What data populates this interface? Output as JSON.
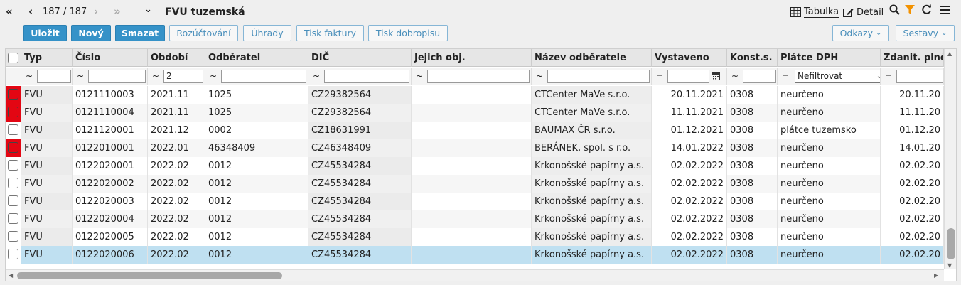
{
  "nav": {
    "first": "«",
    "prev": "‹",
    "counter": "187 / 187",
    "next": "›",
    "last": "»",
    "menu_caret": "⌄",
    "title": "FVU tuzemská"
  },
  "views": {
    "table_label": "Tabulka",
    "detail_label": "Detail"
  },
  "toolbar": {
    "save": "Uložit",
    "new": "Nový",
    "delete": "Smazat",
    "accounting": "Rozúčtování",
    "payments": "Úhrady",
    "print_invoice": "Tisk faktury",
    "print_credit": "Tisk dobropisu",
    "links": "Odkazy",
    "reports": "Sestavy"
  },
  "colors": {
    "primary": "#3592c8",
    "flag_red": "#e30613",
    "selected_row": "#bfe0f1"
  },
  "table": {
    "headers": [
      "Typ",
      "Číslo",
      "Období",
      "Odběratel",
      "DIČ",
      "Jejich obj.",
      "Název odběratele",
      "Vystaveno",
      "Konst.s.",
      "Plátce DPH",
      "Zdanit. plněn"
    ],
    "filters": {
      "ops": [
        "~",
        "~",
        "~",
        "~",
        "~",
        "~",
        "~",
        "=",
        "~",
        "=",
        "="
      ],
      "period_value": "2",
      "vat_payer_select": "Nefiltrovat"
    },
    "rows": [
      {
        "flag": true,
        "typ": "FVU",
        "cislo": "0121110003",
        "obdobi": "2021.11",
        "odberatel": "1025",
        "dic": "CZ29382564",
        "obj": "",
        "nazev": "CTCenter MaVe s.r.o.",
        "vystaveno": "20.11.2021",
        "ks": "0308",
        "platce": "neurčeno",
        "zdan": "20.11.20"
      },
      {
        "flag": true,
        "typ": "FVU",
        "cislo": "0121110004",
        "obdobi": "2021.11",
        "odberatel": "1025",
        "dic": "CZ29382564",
        "obj": "",
        "nazev": "CTCenter MaVe s.r.o.",
        "vystaveno": "11.11.2021",
        "ks": "0308",
        "platce": "neurčeno",
        "zdan": "11.11.20"
      },
      {
        "flag": false,
        "typ": "FVU",
        "cislo": "0121120001",
        "obdobi": "2021.12",
        "odberatel": "0002",
        "dic": "CZ18631991",
        "obj": "",
        "nazev": "BAUMAX ČR s.r.o.",
        "vystaveno": "01.12.2021",
        "ks": "0308",
        "platce": "plátce tuzemsko",
        "zdan": "01.12.20"
      },
      {
        "flag": true,
        "typ": "FVU",
        "cislo": "0122010001",
        "obdobi": "2022.01",
        "odberatel": "46348409",
        "dic": "CZ46348409",
        "obj": "",
        "nazev": "BERÁNEK, spol. s r.o.",
        "vystaveno": "14.01.2022",
        "ks": "0308",
        "platce": "neurčeno",
        "zdan": "14.01.20"
      },
      {
        "flag": false,
        "typ": "FVU",
        "cislo": "0122020001",
        "obdobi": "2022.02",
        "odberatel": "0012",
        "dic": "CZ45534284",
        "obj": "",
        "nazev": "Krkonošské papírny a.s.",
        "vystaveno": "02.02.2022",
        "ks": "0308",
        "platce": "neurčeno",
        "zdan": "02.02.20"
      },
      {
        "flag": false,
        "typ": "FVU",
        "cislo": "0122020002",
        "obdobi": "2022.02",
        "odberatel": "0012",
        "dic": "CZ45534284",
        "obj": "",
        "nazev": "Krkonošské papírny a.s.",
        "vystaveno": "02.02.2022",
        "ks": "0308",
        "platce": "neurčeno",
        "zdan": "02.02.20"
      },
      {
        "flag": false,
        "typ": "FVU",
        "cislo": "0122020003",
        "obdobi": "2022.02",
        "odberatel": "0012",
        "dic": "CZ45534284",
        "obj": "",
        "nazev": "Krkonošské papírny a.s.",
        "vystaveno": "02.02.2022",
        "ks": "0308",
        "platce": "neurčeno",
        "zdan": "02.02.20"
      },
      {
        "flag": false,
        "typ": "FVU",
        "cislo": "0122020004",
        "obdobi": "2022.02",
        "odberatel": "0012",
        "dic": "CZ45534284",
        "obj": "",
        "nazev": "Krkonošské papírny a.s.",
        "vystaveno": "02.02.2022",
        "ks": "0308",
        "platce": "neurčeno",
        "zdan": "02.02.20"
      },
      {
        "flag": false,
        "typ": "FVU",
        "cislo": "0122020005",
        "obdobi": "2022.02",
        "odberatel": "0012",
        "dic": "CZ45534284",
        "obj": "",
        "nazev": "Krkonošské papírny a.s.",
        "vystaveno": "02.02.2022",
        "ks": "0308",
        "platce": "neurčeno",
        "zdan": "02.02.20"
      },
      {
        "flag": false,
        "typ": "FVU",
        "cislo": "0122020006",
        "obdobi": "2022.02",
        "odberatel": "0012",
        "dic": "CZ45534284",
        "obj": "",
        "nazev": "Krkonošské papírny a.s.",
        "vystaveno": "02.02.2022",
        "ks": "0308",
        "platce": "neurčeno",
        "zdan": "02.02.20",
        "selected": true
      }
    ]
  }
}
